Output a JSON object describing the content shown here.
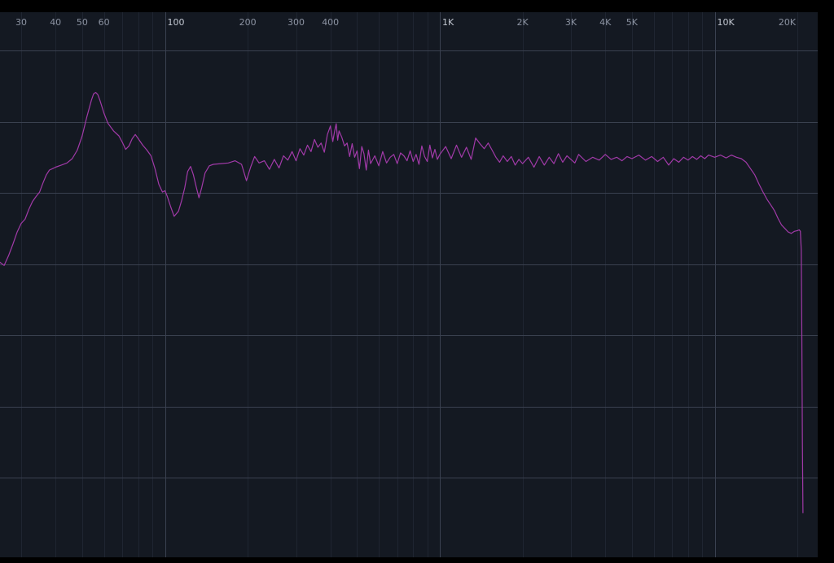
{
  "chart_data": {
    "type": "line",
    "title": "",
    "xlabel": "",
    "ylabel": "",
    "x_scale": "log",
    "xlim": [
      24,
      21000
    ],
    "ylim": [
      -7,
      0
    ],
    "grid": true,
    "legend": "none",
    "colors": {
      "background": "#141922",
      "frame": "#000000",
      "grid_major": "#3a4150",
      "grid_minor": "#1f2531",
      "label": "#8c93a2",
      "label_major": "#c2c7d1",
      "series": "#a13aa8"
    },
    "x_ticks": [
      {
        "value": 30,
        "label": "30",
        "major": false
      },
      {
        "value": 40,
        "label": "40",
        "major": false
      },
      {
        "value": 50,
        "label": "50",
        "major": false
      },
      {
        "value": 60,
        "label": "60",
        "major": false
      },
      {
        "value": 100,
        "label": "100",
        "major": true
      },
      {
        "value": 200,
        "label": "200",
        "major": false
      },
      {
        "value": 300,
        "label": "300",
        "major": false
      },
      {
        "value": 400,
        "label": "400",
        "major": false
      },
      {
        "value": 1000,
        "label": "1K",
        "major": true
      },
      {
        "value": 2000,
        "label": "2K",
        "major": false
      },
      {
        "value": 3000,
        "label": "3K",
        "major": false
      },
      {
        "value": 4000,
        "label": "4K",
        "major": false
      },
      {
        "value": 5000,
        "label": "5K",
        "major": false
      },
      {
        "value": 10000,
        "label": "10K",
        "major": true
      },
      {
        "value": 20000,
        "label": "20K",
        "major": false
      }
    ],
    "x_grid_major": [
      100,
      1000,
      10000
    ],
    "x_grid_minor": [
      30,
      40,
      50,
      60,
      70,
      80,
      90,
      200,
      300,
      400,
      500,
      600,
      700,
      800,
      900,
      2000,
      3000,
      4000,
      5000,
      6000,
      7000,
      8000,
      9000,
      20000
    ],
    "y_grid": [
      -0.5,
      -1.5,
      -2.5,
      -3.5,
      -4.5,
      -5.5,
      -6.5
    ],
    "series": [
      {
        "values": [
          [
            24,
            -3.49
          ],
          [
            25,
            -3.47
          ],
          [
            26,
            -3.52
          ],
          [
            27,
            -3.38
          ],
          [
            28,
            -3.22
          ],
          [
            29,
            -3.05
          ],
          [
            30,
            -2.93
          ],
          [
            31,
            -2.87
          ],
          [
            32,
            -2.73
          ],
          [
            33,
            -2.62
          ],
          [
            34,
            -2.55
          ],
          [
            35,
            -2.49
          ],
          [
            36,
            -2.36
          ],
          [
            37,
            -2.25
          ],
          [
            38,
            -2.18
          ],
          [
            39,
            -2.16
          ],
          [
            40,
            -2.14
          ],
          [
            42,
            -2.11
          ],
          [
            44,
            -2.08
          ],
          [
            46,
            -2.02
          ],
          [
            48,
            -1.9
          ],
          [
            50,
            -1.7
          ],
          [
            52,
            -1.43
          ],
          [
            54,
            -1.2
          ],
          [
            55,
            -1.11
          ],
          [
            56,
            -1.09
          ],
          [
            57,
            -1.12
          ],
          [
            58,
            -1.2
          ],
          [
            60,
            -1.38
          ],
          [
            62,
            -1.52
          ],
          [
            65,
            -1.63
          ],
          [
            68,
            -1.7
          ],
          [
            70,
            -1.79
          ],
          [
            72,
            -1.89
          ],
          [
            74,
            -1.84
          ],
          [
            76,
            -1.74
          ],
          [
            78,
            -1.68
          ],
          [
            80,
            -1.74
          ],
          [
            83,
            -1.83
          ],
          [
            86,
            -1.9
          ],
          [
            89,
            -1.98
          ],
          [
            92,
            -2.16
          ],
          [
            95,
            -2.38
          ],
          [
            98,
            -2.49
          ],
          [
            100,
            -2.47
          ],
          [
            102,
            -2.55
          ],
          [
            105,
            -2.7
          ],
          [
            108,
            -2.83
          ],
          [
            112,
            -2.76
          ],
          [
            115,
            -2.61
          ],
          [
            118,
            -2.43
          ],
          [
            121,
            -2.2
          ],
          [
            124,
            -2.13
          ],
          [
            127,
            -2.25
          ],
          [
            130,
            -2.42
          ],
          [
            133,
            -2.57
          ],
          [
            136,
            -2.43
          ],
          [
            140,
            -2.22
          ],
          [
            145,
            -2.12
          ],
          [
            150,
            -2.1
          ],
          [
            160,
            -2.09
          ],
          [
            170,
            -2.08
          ],
          [
            180,
            -2.05
          ],
          [
            190,
            -2.1
          ],
          [
            198,
            -2.33
          ],
          [
            205,
            -2.14
          ],
          [
            212,
            -1.99
          ],
          [
            220,
            -2.08
          ],
          [
            230,
            -2.05
          ],
          [
            240,
            -2.17
          ],
          [
            250,
            -2.03
          ],
          [
            260,
            -2.15
          ],
          [
            270,
            -1.98
          ],
          [
            280,
            -2.04
          ],
          [
            290,
            -1.92
          ],
          [
            300,
            -2.05
          ],
          [
            310,
            -1.88
          ],
          [
            320,
            -1.97
          ],
          [
            330,
            -1.83
          ],
          [
            340,
            -1.92
          ],
          [
            350,
            -1.75
          ],
          [
            360,
            -1.86
          ],
          [
            370,
            -1.8
          ],
          [
            380,
            -1.93
          ],
          [
            390,
            -1.68
          ],
          [
            400,
            -1.56
          ],
          [
            408,
            -1.78
          ],
          [
            415,
            -1.62
          ],
          [
            420,
            -1.53
          ],
          [
            425,
            -1.76
          ],
          [
            430,
            -1.63
          ],
          [
            440,
            -1.72
          ],
          [
            450,
            -1.84
          ],
          [
            460,
            -1.8
          ],
          [
            470,
            -1.99
          ],
          [
            480,
            -1.81
          ],
          [
            490,
            -2.0
          ],
          [
            500,
            -1.91
          ],
          [
            510,
            -2.16
          ],
          [
            520,
            -1.85
          ],
          [
            530,
            -1.95
          ],
          [
            540,
            -2.18
          ],
          [
            550,
            -1.9
          ],
          [
            560,
            -2.09
          ],
          [
            580,
            -1.98
          ],
          [
            600,
            -2.12
          ],
          [
            620,
            -1.92
          ],
          [
            640,
            -2.08
          ],
          [
            660,
            -2.0
          ],
          [
            680,
            -1.96
          ],
          [
            700,
            -2.09
          ],
          [
            720,
            -1.94
          ],
          [
            740,
            -1.98
          ],
          [
            760,
            -2.05
          ],
          [
            780,
            -1.91
          ],
          [
            800,
            -2.06
          ],
          [
            820,
            -1.96
          ],
          [
            840,
            -2.1
          ],
          [
            860,
            -1.84
          ],
          [
            880,
            -1.99
          ],
          [
            900,
            -2.06
          ],
          [
            920,
            -1.83
          ],
          [
            940,
            -2.01
          ],
          [
            960,
            -1.89
          ],
          [
            980,
            -2.03
          ],
          [
            1000,
            -1.96
          ],
          [
            1050,
            -1.85
          ],
          [
            1100,
            -2.02
          ],
          [
            1150,
            -1.83
          ],
          [
            1200,
            -2.0
          ],
          [
            1250,
            -1.86
          ],
          [
            1300,
            -2.03
          ],
          [
            1350,
            -1.73
          ],
          [
            1400,
            -1.81
          ],
          [
            1450,
            -1.88
          ],
          [
            1500,
            -1.8
          ],
          [
            1550,
            -1.9
          ],
          [
            1600,
            -2.0
          ],
          [
            1650,
            -2.07
          ],
          [
            1700,
            -1.98
          ],
          [
            1760,
            -2.06
          ],
          [
            1820,
            -1.99
          ],
          [
            1880,
            -2.11
          ],
          [
            1940,
            -2.03
          ],
          [
            2000,
            -2.09
          ],
          [
            2100,
            -2.0
          ],
          [
            2200,
            -2.14
          ],
          [
            2300,
            -1.99
          ],
          [
            2400,
            -2.11
          ],
          [
            2500,
            -2.0
          ],
          [
            2600,
            -2.09
          ],
          [
            2700,
            -1.95
          ],
          [
            2800,
            -2.07
          ],
          [
            2900,
            -1.98
          ],
          [
            3000,
            -2.03
          ],
          [
            3100,
            -2.08
          ],
          [
            3200,
            -1.96
          ],
          [
            3400,
            -2.06
          ],
          [
            3600,
            -2.0
          ],
          [
            3800,
            -2.04
          ],
          [
            4000,
            -1.96
          ],
          [
            4200,
            -2.03
          ],
          [
            4400,
            -2.0
          ],
          [
            4600,
            -2.05
          ],
          [
            4800,
            -1.99
          ],
          [
            5000,
            -2.02
          ],
          [
            5300,
            -1.97
          ],
          [
            5600,
            -2.04
          ],
          [
            5900,
            -1.99
          ],
          [
            6200,
            -2.06
          ],
          [
            6500,
            -2.0
          ],
          [
            6800,
            -2.11
          ],
          [
            7100,
            -2.02
          ],
          [
            7400,
            -2.07
          ],
          [
            7700,
            -2.0
          ],
          [
            8000,
            -2.04
          ],
          [
            8300,
            -1.99
          ],
          [
            8600,
            -2.03
          ],
          [
            8900,
            -1.98
          ],
          [
            9200,
            -2.02
          ],
          [
            9500,
            -1.97
          ],
          [
            10000,
            -2.0
          ],
          [
            10500,
            -1.97
          ],
          [
            11000,
            -2.01
          ],
          [
            11500,
            -1.97
          ],
          [
            12000,
            -2.0
          ],
          [
            12500,
            -2.02
          ],
          [
            13000,
            -2.07
          ],
          [
            13500,
            -2.16
          ],
          [
            14000,
            -2.25
          ],
          [
            14500,
            -2.38
          ],
          [
            15000,
            -2.49
          ],
          [
            15500,
            -2.59
          ],
          [
            16000,
            -2.67
          ],
          [
            16500,
            -2.75
          ],
          [
            17000,
            -2.86
          ],
          [
            17500,
            -2.95
          ],
          [
            18000,
            -3.0
          ],
          [
            18500,
            -3.05
          ],
          [
            19000,
            -3.07
          ],
          [
            19500,
            -3.04
          ],
          [
            20000,
            -3.03
          ],
          [
            20300,
            -3.02
          ],
          [
            20500,
            -3.04
          ],
          [
            20650,
            -3.3
          ],
          [
            20750,
            -4.5
          ],
          [
            20850,
            -6.0
          ],
          [
            20950,
            -7.0
          ]
        ]
      }
    ]
  }
}
